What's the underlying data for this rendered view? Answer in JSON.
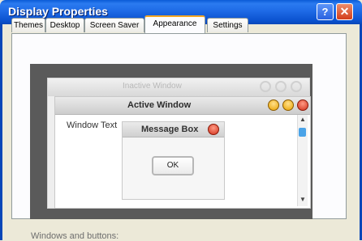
{
  "window": {
    "title": "Display Properties"
  },
  "titlebar_buttons": {
    "help": "?",
    "close": "✕"
  },
  "tabs": [
    {
      "label": "Themes"
    },
    {
      "label": "Desktop"
    },
    {
      "label": "Screen Saver"
    },
    {
      "label": "Appearance",
      "active": true
    },
    {
      "label": "Settings"
    }
  ],
  "preview": {
    "inactive_window_title": "Inactive Window",
    "active_window_title": "Active Window",
    "window_text": "Window Text",
    "message_box_title": "Message Box",
    "ok_label": "OK"
  },
  "bottom_caption": "Windows and buttons:",
  "colors": {
    "titlebar": "#0b52cf",
    "dialog_bg": "#ece9d8",
    "active_tab_highlight": "#f5a623",
    "preview_bg": "#5a5a5a",
    "close_button": "#d1301a",
    "minimize_button": "#e9a200"
  }
}
